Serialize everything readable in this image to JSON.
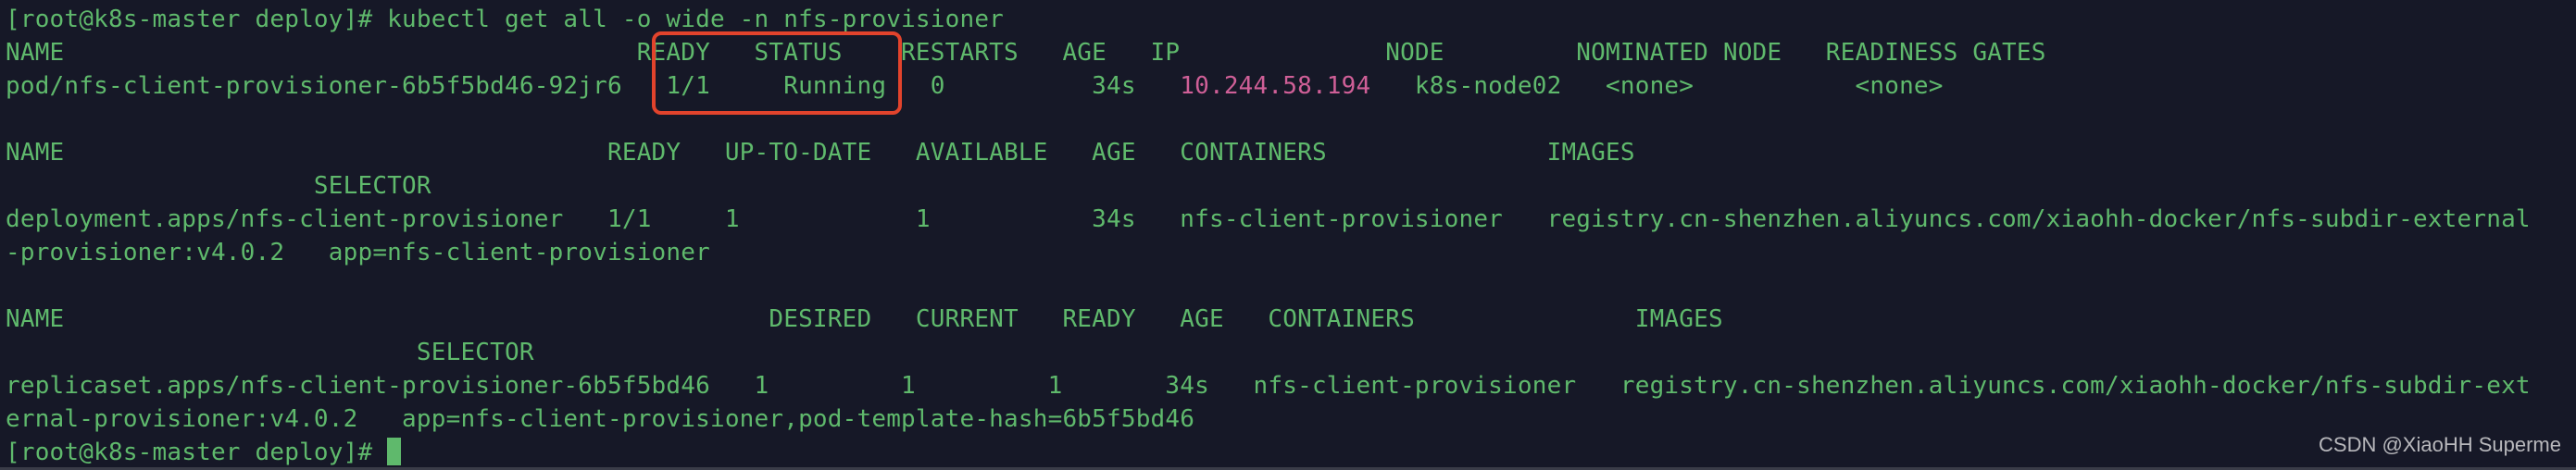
{
  "terminal": {
    "colors": {
      "background": "#161827",
      "text": "#5fb96c",
      "ip": "#cf5f97",
      "highlight": "#e2432c"
    },
    "lines": [
      [
        {
          "text": "[root@k8s-master deploy]# kubectl get all -o wide -n nfs-provisioner"
        }
      ],
      [
        {
          "text": "NAME                                       READY   STATUS    RESTARTS   AGE   IP              NODE         NOMINATED NODE   READINESS GATES"
        }
      ],
      [
        {
          "text": "pod/nfs-client-provisioner-6b5f5bd46-92jr6   1/1     Running   0          34s   "
        },
        {
          "text": "10.244.58.194",
          "kind": "ip"
        },
        {
          "text": "   k8s-node02   <none>           <none>"
        }
      ],
      [
        {
          "text": ""
        }
      ],
      [
        {
          "text": "NAME                                     READY   UP-TO-DATE   AVAILABLE   AGE   CONTAINERS               IMAGES"
        }
      ],
      [
        {
          "text": "                     SELECTOR"
        }
      ],
      [
        {
          "text": "deployment.apps/nfs-client-provisioner   1/1     1            1           34s   nfs-client-provisioner   registry.cn-shenzhen.aliyuncs.com/xiaohh-docker/nfs-subdir-external"
        }
      ],
      [
        {
          "text": "-provisioner:v4.0.2   app=nfs-client-provisioner"
        }
      ],
      [
        {
          "text": ""
        }
      ],
      [
        {
          "text": "NAME                                                DESIRED   CURRENT   READY   AGE   CONTAINERS               IMAGES"
        }
      ],
      [
        {
          "text": "                            SELECTOR"
        }
      ],
      [
        {
          "text": "replicaset.apps/nfs-client-provisioner-6b5f5bd46   1         1         1       34s   nfs-client-provisioner   registry.cn-shenzhen.aliyuncs.com/xiaohh-docker/nfs-subdir-ext"
        }
      ],
      [
        {
          "text": "ernal-provisioner:v4.0.2   app=nfs-client-provisioner,pod-template-hash=6b5f5bd46"
        }
      ],
      [
        {
          "text": "[root@k8s-master deploy]# "
        }
      ]
    ]
  },
  "watermark": "CSDN @XiaoHH Superme"
}
